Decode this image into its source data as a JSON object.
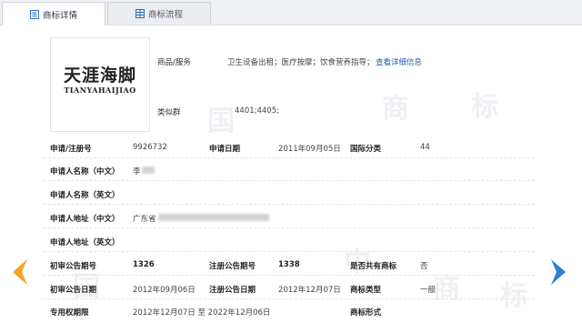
{
  "tabs": [
    {
      "label": "商标详情",
      "icon": "list-icon"
    },
    {
      "label": "商标流程",
      "icon": "grid-icon"
    }
  ],
  "logo": {
    "cn": "天涯海脚",
    "en": "TIANYAHAIJIAO"
  },
  "goods": {
    "label": "商品/服务",
    "value": "卫生设备出租；医疗按摩；饮食营养指导；",
    "link": "查看详细信息"
  },
  "similar_group": {
    "label": "类似群",
    "value": "4401;4405;"
  },
  "fields": {
    "reg_no": {
      "label": "申请/注册号",
      "value": "9926732"
    },
    "apply_date": {
      "label": "申请日期",
      "value": "2011年09月05日"
    },
    "intl_class": {
      "label": "国际分类",
      "value": "44"
    },
    "applicant_cn": {
      "label": "申请人名称（中文）",
      "value": "李"
    },
    "applicant_en": {
      "label": "申请人名称（英文）",
      "value": ""
    },
    "address_cn": {
      "label": "申请人地址（中文）",
      "value": "广东省"
    },
    "address_en": {
      "label": "申请人地址（英文）",
      "value": ""
    },
    "prelim_issue": {
      "label": "初审公告期号",
      "value": "1326"
    },
    "reg_issue": {
      "label": "注册公告期号",
      "value": "1338"
    },
    "shared": {
      "label": "是否共有商标",
      "value": "否"
    },
    "prelim_date": {
      "label": "初审公告日期",
      "value": "2012年09月06日"
    },
    "reg_date": {
      "label": "注册公告日期",
      "value": "2012年12月07日"
    },
    "tm_type": {
      "label": "商标类型",
      "value": "一般"
    },
    "exclusive_period": {
      "label": "专用权期限",
      "value": "2012年12月07日 至 2022年12月06日"
    },
    "tm_form": {
      "label": "商标形式",
      "value": ""
    }
  },
  "colors": {
    "accent": "#1f5fb5",
    "arrow_left": "#f5a623",
    "arrow_right": "#2f7fd6"
  }
}
